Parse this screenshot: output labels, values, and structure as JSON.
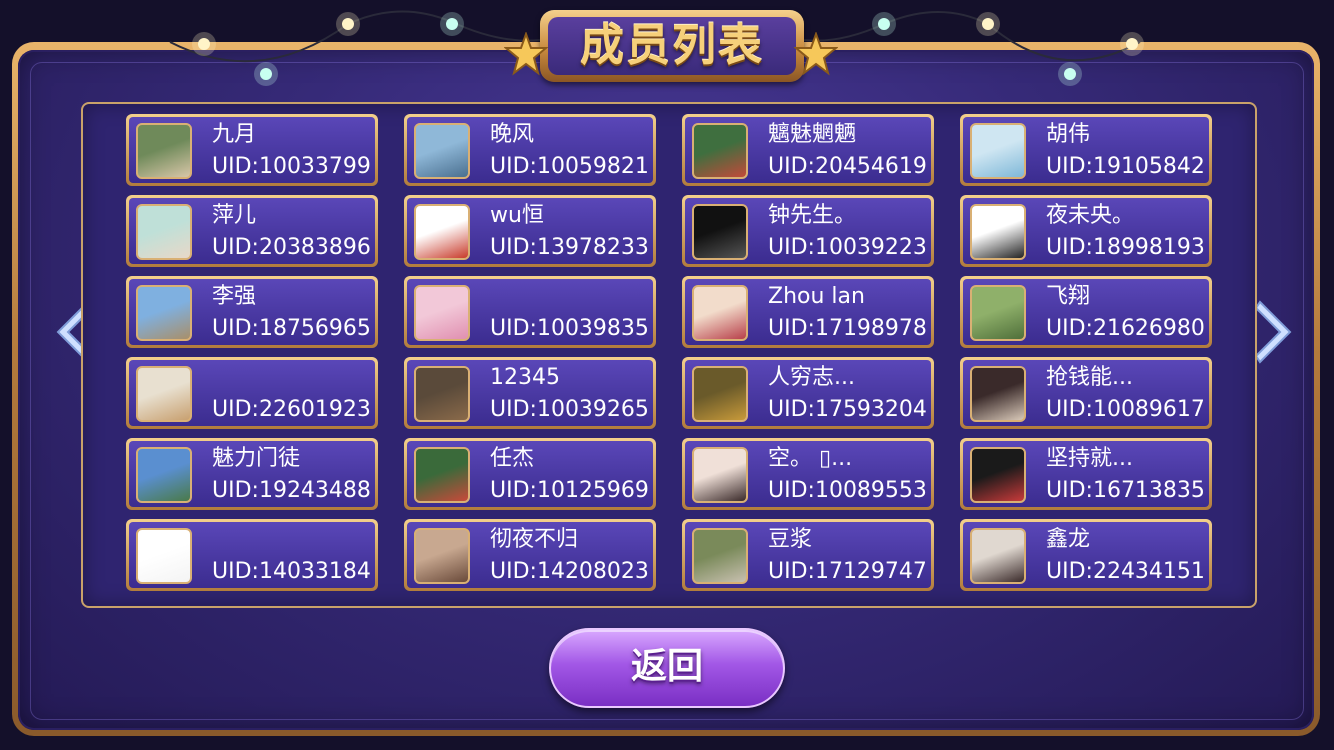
{
  "header": {
    "title": "成员列表"
  },
  "members": [
    {
      "name": "九月",
      "uid": "UID:10033799",
      "avatar": {
        "c1": "#6f8a5a",
        "c2": "#d8c6a8"
      }
    },
    {
      "name": "晚风",
      "uid": "UID:10059821",
      "avatar": {
        "c1": "#8fb8d8",
        "c2": "#4a6f8f"
      }
    },
    {
      "name": "魑魅魍魉",
      "uid": "UID:20454619",
      "avatar": {
        "c1": "#3f6f3f",
        "c2": "#c24a3a"
      }
    },
    {
      "name": "胡伟",
      "uid": "UID:19105842",
      "avatar": {
        "c1": "#cfe6f2",
        "c2": "#7fb8d8"
      }
    },
    {
      "name": "萍儿",
      "uid": "UID:20383896",
      "avatar": {
        "c1": "#bfe0d8",
        "c2": "#e8d8c8"
      }
    },
    {
      "name": "wu恒",
      "uid": "UID:13978233",
      "avatar": {
        "c1": "#ffffff",
        "c2": "#c83a2a"
      }
    },
    {
      "name": "钟先生。",
      "uid": "UID:10039223",
      "avatar": {
        "c1": "#111111",
        "c2": "#555555"
      }
    },
    {
      "name": "夜未央。",
      "uid": "UID:18998193",
      "avatar": {
        "c1": "#ffffff",
        "c2": "#222222"
      }
    },
    {
      "name": "李强",
      "uid": "UID:18756965",
      "avatar": {
        "c1": "#7fb0e0",
        "c2": "#a88f6a"
      }
    },
    {
      "name": "",
      "uid": "UID:10039835",
      "avatar": {
        "c1": "#f2c8d8",
        "c2": "#e08fb0"
      }
    },
    {
      "name": "Zhou lan",
      "uid": "UID:17198978",
      "avatar": {
        "c1": "#f2dccb",
        "c2": "#b8404a"
      }
    },
    {
      "name": "飞翔",
      "uid": "UID:21626980",
      "avatar": {
        "c1": "#8fb06a",
        "c2": "#4f6f3a"
      }
    },
    {
      "name": "",
      "uid": "UID:22601923",
      "avatar": {
        "c1": "#e8e0d0",
        "c2": "#c8a070"
      }
    },
    {
      "name": "12345",
      "uid": "UID:10039265",
      "avatar": {
        "c1": "#5a4a3a",
        "c2": "#8a6a4a"
      }
    },
    {
      "name": "人穷志...",
      "uid": "UID:17593204",
      "avatar": {
        "c1": "#6a5a2a",
        "c2": "#c89a3a"
      }
    },
    {
      "name": "抢钱能...",
      "uid": "UID:10089617",
      "avatar": {
        "c1": "#3a2a2a",
        "c2": "#d8c8b8"
      }
    },
    {
      "name": "魅力门徒",
      "uid": "UID:19243488",
      "avatar": {
        "c1": "#5a8fd0",
        "c2": "#4a7a4a"
      }
    },
    {
      "name": "任杰",
      "uid": "UID:10125969",
      "avatar": {
        "c1": "#3a6a3a",
        "c2": "#c84a3a"
      }
    },
    {
      "name": "空。 ▯...",
      "uid": "UID:10089553",
      "avatar": {
        "c1": "#f0e0d8",
        "c2": "#3a2a2a"
      }
    },
    {
      "name": "坚持就...",
      "uid": "UID:16713835",
      "avatar": {
        "c1": "#1a1a1a",
        "c2": "#c83a3a"
      }
    },
    {
      "name": "",
      "uid": "UID:14033184",
      "avatar": {
        "c1": "#ffffff",
        "c2": "#f4f4f4"
      }
    },
    {
      "name": "彻夜不归",
      "uid": "UID:14208023",
      "avatar": {
        "c1": "#c8a890",
        "c2": "#6a4a3a"
      }
    },
    {
      "name": "豆浆",
      "uid": "UID:17129747",
      "avatar": {
        "c1": "#7a8a5a",
        "c2": "#c8c0b0"
      }
    },
    {
      "name": "鑫龙",
      "uid": "UID:22434151",
      "avatar": {
        "c1": "#e0d8d0",
        "c2": "#3a2a2a"
      }
    }
  ],
  "footer": {
    "back_label": "返回"
  }
}
